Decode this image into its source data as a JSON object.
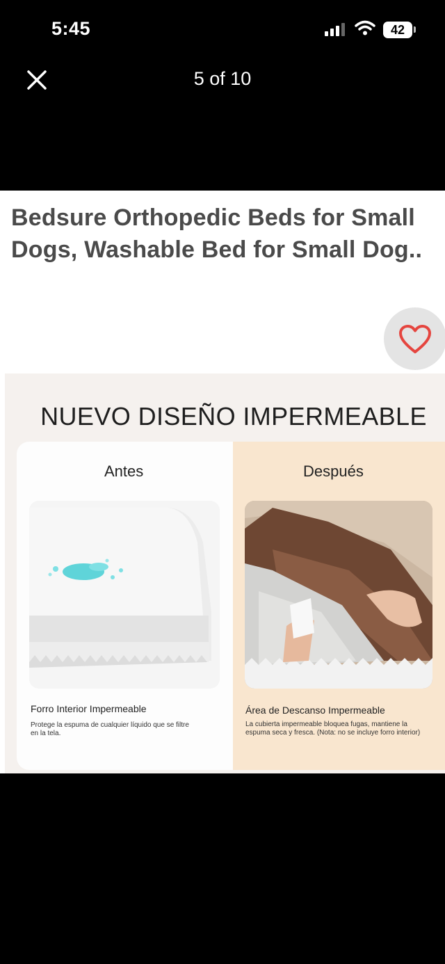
{
  "status_bar": {
    "time": "5:45",
    "battery": "42"
  },
  "viewer": {
    "counter": "5 of 10"
  },
  "product": {
    "title": "Bedsure Orthopedic Beds for Small Dogs, Washable Bed for Small Dog.."
  },
  "promo": {
    "headline": "NUEVO DISEÑO IMPERMEABLE",
    "before": {
      "heading": "Antes",
      "caption_title": "Forro Interior Impermeable",
      "caption_text": "Protege la espuma de cualquier líquido que se filtre en la tela."
    },
    "after": {
      "heading": "Después",
      "caption_title": "Área de Descanso Impermeable",
      "caption_text": "La cubierta impermeable bloquea fugas, mantiene la espuma seca y fresca. (Nota: no se incluye forro interior)"
    }
  },
  "colors": {
    "heart": "#e5453f",
    "accent_panel": "#f9e6cf",
    "promo_bg": "#f5f1ee"
  },
  "icons": [
    "signal-icon",
    "wifi-icon",
    "battery-icon",
    "close-icon",
    "heart-icon"
  ]
}
